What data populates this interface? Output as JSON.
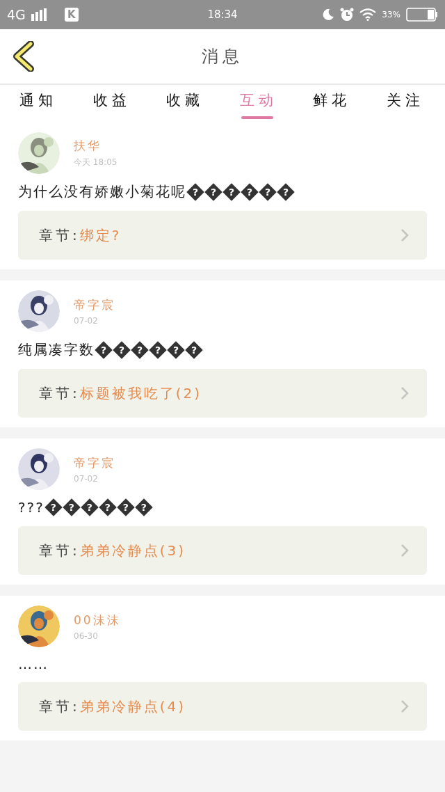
{
  "status_bar": {
    "network": "4G",
    "app_badge": "K",
    "time": "18:34",
    "battery": "33%"
  },
  "header": {
    "title": "消息"
  },
  "tabs": [
    {
      "label": "通知",
      "selected": false
    },
    {
      "label": "收益",
      "selected": false
    },
    {
      "label": "收藏",
      "selected": false
    },
    {
      "label": "互动",
      "selected": true
    },
    {
      "label": "鲜花",
      "selected": false
    },
    {
      "label": "关注",
      "selected": false
    }
  ],
  "messages": [
    {
      "user": "扶华",
      "time": "今天 18:05",
      "text": "为什么没有娇嫩小菊花呢",
      "glyph_marks": [
        "?",
        "?",
        "?",
        "?",
        "?",
        "?"
      ],
      "chapter_label": "章节:",
      "chapter_title": "绑定?"
    },
    {
      "user": "帝字宸",
      "time": "07-02",
      "text": "纯属凑字数",
      "glyph_marks": [
        "?",
        "?",
        "?",
        "?",
        "?",
        "?"
      ],
      "chapter_label": "章节:",
      "chapter_title": "标题被我吃了(2)"
    },
    {
      "user": "帝字宸",
      "time": "07-02",
      "text": "???",
      "glyph_marks": [
        "?",
        "?",
        "?",
        "?",
        "?",
        "?"
      ],
      "chapter_label": "章节:",
      "chapter_title": "弟弟冷静点(3)"
    },
    {
      "user": "00沫沫",
      "time": "06-30",
      "text": "……",
      "chapter_label": "章节:",
      "chapter_title": "弟弟冷静点(4)"
    }
  ]
}
